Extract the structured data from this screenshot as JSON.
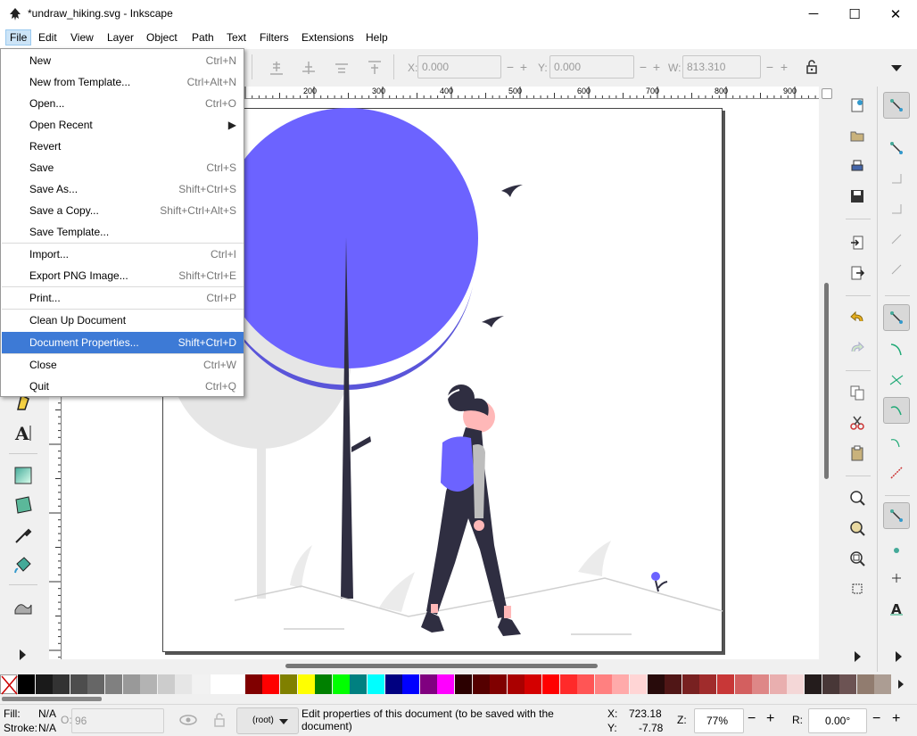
{
  "window": {
    "title": "*undraw_hiking.svg - Inkscape",
    "minimize": "─",
    "maximize": "☐",
    "close": "✕"
  },
  "menubar": [
    "File",
    "Edit",
    "View",
    "Layer",
    "Object",
    "Path",
    "Text",
    "Filters",
    "Extensions",
    "Help"
  ],
  "file_menu": {
    "items": [
      {
        "label": "New",
        "shortcut": "Ctrl+N"
      },
      {
        "label": "New from Template...",
        "shortcut": "Ctrl+Alt+N"
      },
      {
        "label": "Open...",
        "shortcut": "Ctrl+O"
      },
      {
        "label": "Open Recent",
        "shortcut": "▶"
      },
      {
        "label": "Revert",
        "shortcut": ""
      },
      {
        "label": "Save",
        "shortcut": "Ctrl+S"
      },
      {
        "label": "Save As...",
        "shortcut": "Shift+Ctrl+S"
      },
      {
        "label": "Save a Copy...",
        "shortcut": "Shift+Ctrl+Alt+S"
      },
      {
        "label": "Save Template...",
        "shortcut": ""
      },
      {
        "label": "Import...",
        "shortcut": "Ctrl+I"
      },
      {
        "label": "Export PNG Image...",
        "shortcut": "Shift+Ctrl+E"
      },
      {
        "label": "Print...",
        "shortcut": "Ctrl+P"
      },
      {
        "label": "Clean Up Document",
        "shortcut": ""
      },
      {
        "label": "Document Properties...",
        "shortcut": "Shift+Ctrl+D"
      },
      {
        "label": "Close",
        "shortcut": "Ctrl+W"
      },
      {
        "label": "Quit",
        "shortcut": "Ctrl+Q"
      }
    ],
    "highlighted": "Document Properties..."
  },
  "tool_controls": {
    "x_label": "X:",
    "x_value": "0.000",
    "y_label": "Y:",
    "y_value": "0.000",
    "w_label": "W:",
    "w_value": "813.310",
    "minus": "−",
    "plus": "+"
  },
  "ruler_ticks": [
    "200",
    "300",
    "400",
    "500",
    "600",
    "700",
    "800",
    "900"
  ],
  "status": {
    "fill_label": "Fill:",
    "fill_value": "N/A",
    "stroke_label": "Stroke:",
    "stroke_value": "N/A",
    "opacity_label": "O:",
    "opacity_value": "96",
    "layer": "(root)",
    "message": "Edit properties of this document (to be saved with the document)",
    "x_label": "X:",
    "x_value": "723.18",
    "y_label": "Y:",
    "y_value": "-7.78",
    "zoom_label": "Z:",
    "zoom_value": "77%",
    "rotate_label": "R:",
    "rotate_value": "0.00°"
  },
  "palette_colors": [
    "#000000",
    "#1a1a1a",
    "#333333",
    "#4d4d4d",
    "#666666",
    "#808080",
    "#999999",
    "#b3b3b3",
    "#cccccc",
    "#e6e6e6",
    "#f2f2f2",
    "#ffffff",
    "#ffffff",
    "#800000",
    "#ff0000",
    "#808000",
    "#ffff00",
    "#008000",
    "#00ff00",
    "#008080",
    "#00ffff",
    "#000080",
    "#0000ff",
    "#800080",
    "#ff00ff",
    "#2b0000",
    "#550000",
    "#800000",
    "#aa0000",
    "#d40000",
    "#ff0000",
    "#ff2a2a",
    "#ff5555",
    "#ff8080",
    "#ffaaaa",
    "#ffd5d5",
    "#280b0b",
    "#501616",
    "#782121",
    "#a02c2c",
    "#c83737",
    "#d35f5f",
    "#de8787",
    "#e9afaf",
    "#f4d7d7",
    "#241c1c",
    "#483737",
    "#6c5353",
    "#917c6f",
    "#ac9d93"
  ],
  "colors": {
    "accent": "#6c63ff",
    "accent_dark": "#575ad6",
    "figure": "#2f2e41",
    "ground": "#e6e6e6",
    "menu_highlight": "#3d7ad6"
  }
}
